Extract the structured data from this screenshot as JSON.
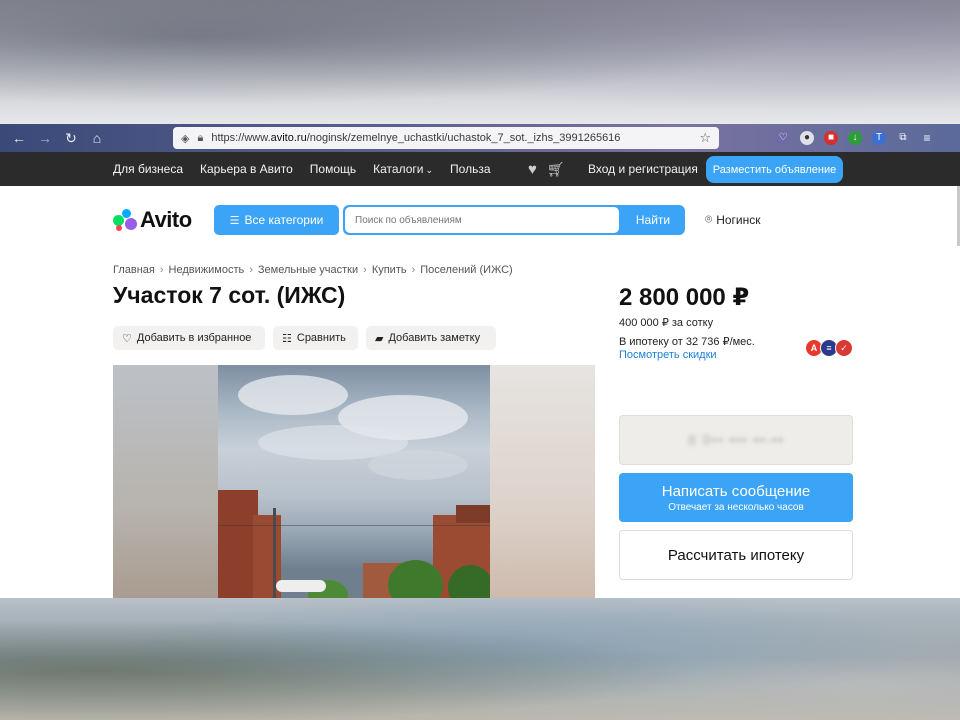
{
  "browser": {
    "url_prefix": "https://www.",
    "url_domain": "avito.ru",
    "url_path": "/noginsk/zemelnye_uchastki/uchastok_7_sot._izhs_3991265616"
  },
  "topmenu": {
    "items": [
      "Для бизнеса",
      "Карьера в Авито",
      "Помощь",
      "Каталоги",
      "Польза"
    ],
    "login": "Вход и регистрация",
    "post_ad": "Разместить объявление"
  },
  "header": {
    "logo": "Avito",
    "categories": "Все категории",
    "search_placeholder": "Поиск по объявлениям",
    "search_button": "Найти",
    "location": "Ногинск"
  },
  "breadcrumbs": [
    "Главная",
    "Недвижимость",
    "Земельные участки",
    "Купить",
    "Поселений (ИЖС)"
  ],
  "listing": {
    "title": "Участок 7 сот. (ИЖС)",
    "actions": {
      "favorite": "Добавить в избранное",
      "compare": "Сравнить",
      "note": "Добавить заметку"
    }
  },
  "sidebar": {
    "price": "2 800 000 ₽",
    "price_per_unit": "400 000 ₽ за сотку",
    "mortgage": "В ипотеку от 32 736 ₽/мес.",
    "discounts": "Посмотреть скидки",
    "phone_hidden": "8 9•• ••• ••-••",
    "message_button": "Написать сообщение",
    "message_sub": "Отвечает за несколько часов",
    "calc_button": "Рассчитать ипотеку"
  },
  "colors": {
    "accent": "#3ba4f6",
    "topbar": "#2b2b2b",
    "link": "#1a7fd4"
  }
}
